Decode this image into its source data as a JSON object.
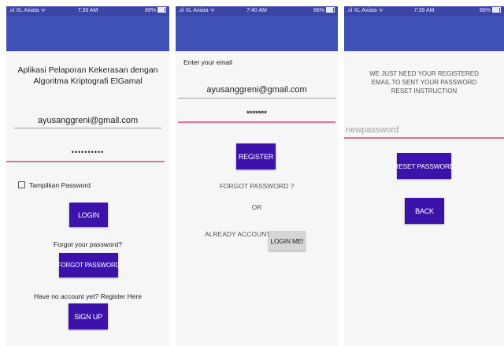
{
  "status_bars": [
    {
      "carrier": ".ııl XL Axiata ᯤ",
      "time": "7:36 AM",
      "battery": "89%"
    },
    {
      "carrier": ".ııl XL Axiata ᯤ",
      "time": "7:40 AM",
      "battery": "88%"
    },
    {
      "carrier": ".ııl XL Axiata ᯤ",
      "time": "7:39 AM",
      "battery": "88%"
    }
  ],
  "login": {
    "title": "Aplikasi Pelaporan Kekerasan dengan Algoritma Kriptografi ElGamal",
    "email_value": "ayusanggreni@gmail.com",
    "password_value": "••••••••••",
    "show_password_label": "Tampilkan Password",
    "login_button": "LOGIN",
    "forgot_prompt": "Forgot your password?",
    "forgot_button": "FORGOT PASSWORD",
    "register_prompt": "Have no account yet? Register Here",
    "signup_button": "SIGN UP"
  },
  "register": {
    "email_label": "Enter your email",
    "email_value": "ayusanggreni@gmail.com",
    "password_value": "*******",
    "register_button": "REGISTER",
    "forgot_text": "FORGOT PASSWORD ?",
    "or_text": "OR",
    "already_text": "ALREADY ACCOUNT ?",
    "login_me_button": "LOGIN ME!"
  },
  "reset": {
    "instruction": "WE JUST NEED YOUR REGISTERED EMAIL TO SENT YOUR PASSWORD RESET INSTRUCTION",
    "new_password_placeholder": "newpassword",
    "reset_button": "RESET PASSWORD",
    "back_button": "BACK"
  }
}
